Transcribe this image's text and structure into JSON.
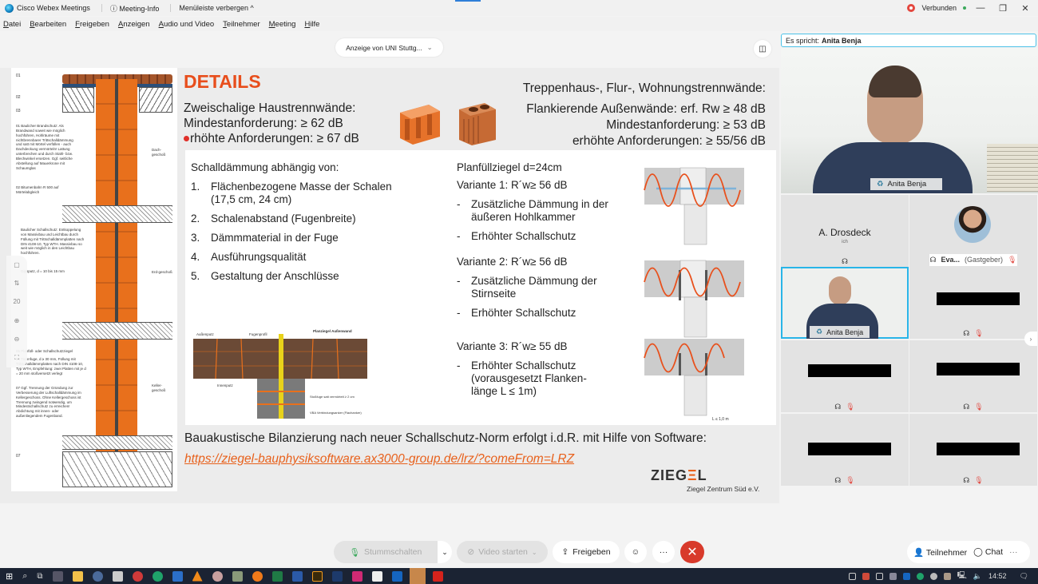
{
  "titlebar": {
    "app_name": "Cisco Webex Meetings",
    "meeting_info": "Meeting-Info",
    "hide_menubar": "Menüleiste verbergen ^",
    "status": "Verbunden",
    "minimize": "—",
    "restore": "❐",
    "close": "✕"
  },
  "menubar": [
    "Datei",
    "Bearbeiten",
    "Freigeben",
    "Anzeigen",
    "Audio und Video",
    "Teilnehmer",
    "Meeting",
    "Hilfe"
  ],
  "share": {
    "viewing_label": "Anzeige von UNI Stuttg...",
    "viewing_chevron": "⌄",
    "layout_icon": "◫",
    "side_controls": [
      "▢",
      "⇅",
      "20",
      "⊕",
      "⊖",
      "⛶"
    ]
  },
  "slide": {
    "title": "DETAILS",
    "left_header": {
      "line1": "Zweischalige Haustrennwände:",
      "line2": "Mindestanforderung: ≥ 62 dB",
      "line3": "rhöhte Anforderungen: ≥ 67 dB"
    },
    "right_header": {
      "line1": "Treppenhaus-, Flur-, Wohnungstrennwände:",
      "line2": "Flankierende Außenwände: erf. Rw ≥ 48 dB",
      "line3": "Mindestanforderung: ≥ 53 dB",
      "line4": "erhöhte Anforderungen: ≥ 55/56 dB"
    },
    "schall": {
      "heading": "Schalldämmung abhängig von:",
      "items": [
        {
          "n": "1.",
          "text": "Flächenbezogene Masse der Schalen",
          "text2": "(17,5 cm, 24 cm)"
        },
        {
          "n": "2.",
          "text": "Schalenabstand (Fugenbreite)",
          "text2": ""
        },
        {
          "n": "3.",
          "text": "Dämmmaterial in der Fuge",
          "text2": ""
        },
        {
          "n": "4.",
          "text": "Ausführungsqualität",
          "text2": ""
        },
        {
          "n": "5.",
          "text": "Gestaltung der Anschlüsse",
          "text2": ""
        }
      ]
    },
    "planf": {
      "heading": "Planfüllziegel d=24cm",
      "variants": [
        {
          "title": "Variante 1: R´w≥ 56 dB",
          "bullets": [
            "Zusätzliche Dämmung in der äußeren Hohlkammer",
            "Erhöhter Schallschutz"
          ]
        },
        {
          "title": "Variante 2: R´w≥ 56 dB",
          "bullets": [
            "Zusätzliche Dämmung der Stirnseite",
            "Erhöhter Schallschutz"
          ]
        },
        {
          "title": "Variante 3: R´w≥ 55 dB",
          "bullets": [
            "Erhöhter Schallschutz (vorausgesetzt Flanken-länge L ≤ 1m)"
          ]
        }
      ]
    },
    "tdetail_labels": {
      "aussenputz": "Außenputz",
      "fugenprofil": "Fugenprofil",
      "planziegel": "Planziegel Außenwand",
      "innenputz": "Innenputz",
      "stossfuge": "Stoßfuge satt vermörtelt ≥ 2 cm",
      "anker": "VBA Verbindungsanker (Flachanker)"
    },
    "drawing_labels": {
      "nums": [
        "01",
        "02",
        "03",
        "05",
        "06",
        "07"
      ],
      "dach": "Dach-geschoß",
      "erd": "Erd-geschoß",
      "keller": "Keller-geschoß",
      "note01": "01 Baulicher Brandschutz: Als Brandwand soweit wie möglich hochführen, Hohlräume mit nichtbrennbarer Trittschalldämmung und satt mit Mörtel verfüllen - auch Dachdeckung vermörteln! Lattung unterbrechen und durch Stahl- bzw. Blechwinkel ersetzen. Ggf. seitliche Abstellung auf Mauerkrone mit Schaumglas",
      "note02": "02 Bitumenbahn R 500 auf Mörtelabgleich",
      "note_schall": "Baulicher Schallschutz: Entkoppelung von Massivbau und Leichtbau durch Füllung mit Trittschalldämmplatten nach DIN 4108-10, Typ WTH. Massivbau so weit wie möglich in den Leichtbau hochführen.",
      "note_putz": "Gipsputz, d = 10 bis 15 mm",
      "note05": "05 Planfüll- oder Schallschutzziegel",
      "note06": "06 Trennfuge, d ≥ 30 mm, Füllung mit Trittschalldämmplatten nach DIN 4108-10, Typ WTH, Empfehlung: zwei Platten mit je d = 20 mm stoßversetzt verlegt",
      "note07": "07 Ggf. Trennung der Gründung zur Verbesserung der Luftschalldämmung im Kellergeschoss. Ohne Kellergeschoss ist Trennung zwingend notwendig, um Mindestschallschutz zu erreichen! Abdichtung mit innen- oder außenliegendem Fugenband."
    },
    "vdiag_length": "L ≤ 1,0 m",
    "bottom_text": "Bauakustische Bilanzierung nach neuer Schallschutz-Norm erfolgt i.d.R. mit Hilfe von Software:",
    "link": "https://ziegel-bauphysiksoftware.ax3000-group.de/lrz/?comeFrom=LRZ",
    "logo_a": "ZIEG",
    "logo_e": "Ξ",
    "logo_b": "L",
    "logo_sub": "Ziegel Zentrum Süd e.V."
  },
  "participants_panel": {
    "speaking_label": "Es spricht:",
    "speaking_name": "Anita Benja",
    "main_video_name": "Anita Benja",
    "tiles": [
      {
        "name": "A. Drosdeck",
        "sub": "ich",
        "muted": false
      },
      {
        "name": "Eva...",
        "role": "(Gastgeber)",
        "muted": true
      },
      {
        "name": "Anita Benja",
        "active": true
      },
      {
        "name": "",
        "redacted": true,
        "muted": true
      },
      {
        "name": "",
        "redacted": true,
        "muted": true
      },
      {
        "name": "",
        "redacted": true,
        "muted": true
      },
      {
        "name": "",
        "redacted": true,
        "muted": true
      },
      {
        "name": "",
        "redacted": true,
        "muted": true
      }
    ],
    "next_page": "›"
  },
  "controls": {
    "mute": "Stummschalten",
    "mute_chevron": "⌄",
    "video": "Video starten",
    "video_chevron": "⌄",
    "share": "Freigeben",
    "reactions": "☺",
    "more": "···",
    "end": "✕",
    "participants": "Teilnehmer",
    "chat": "Chat",
    "panel_more": "···"
  },
  "taskbar": {
    "time": "14:52",
    "icons": [
      "start",
      "search",
      "task-view",
      "calculator",
      "explorer",
      "app",
      "mail",
      "browser-red",
      "shield",
      "visio",
      "vlc",
      "app2",
      "app3",
      "firefox",
      "excel",
      "word",
      "illustrator",
      "photoshop",
      "indesign",
      "acrobat-reader",
      "outlook",
      "webex",
      "acrobat"
    ],
    "colors": {
      "excel": "#1f7a45",
      "word": "#2b5aa8",
      "outlook": "#1565c0",
      "acrobat": "#d4231c",
      "illustrator": "#f39a1b",
      "indesign": "#d02a74",
      "photoshop": "#1d3a6b",
      "firefox": "#f07a1a",
      "explorer": "#f2c14a",
      "visio": "#2b6fc9",
      "webex-active": "#c7874b"
    }
  }
}
